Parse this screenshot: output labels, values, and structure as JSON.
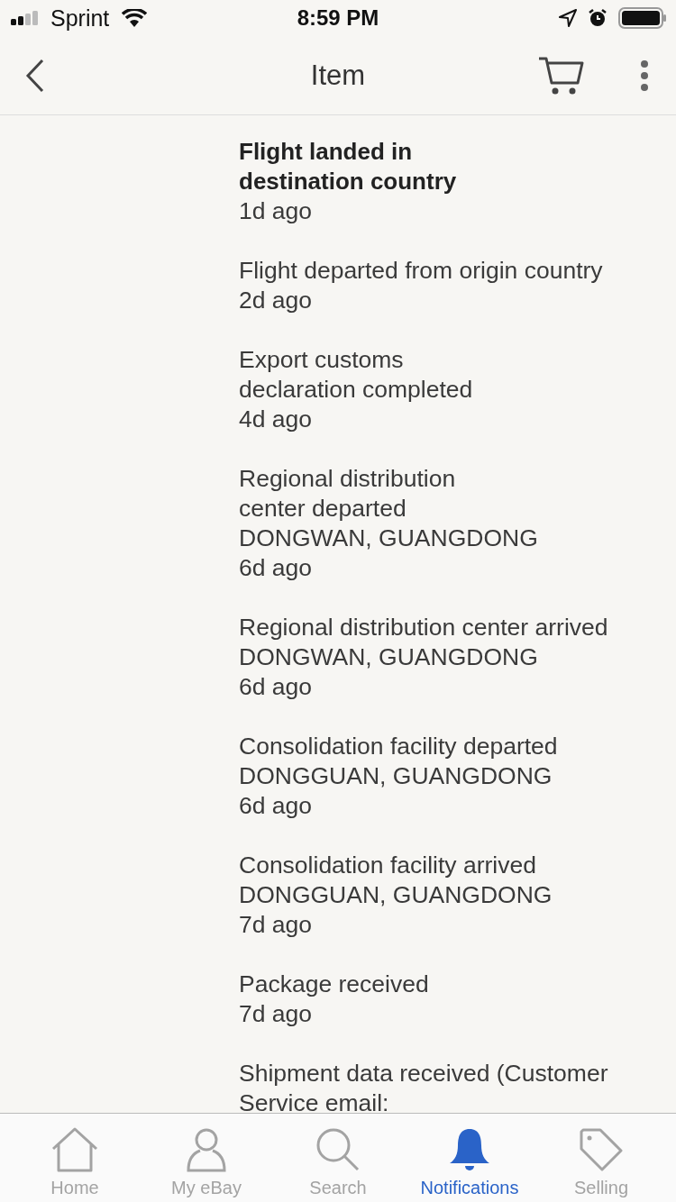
{
  "status_bar": {
    "carrier": "Sprint",
    "time": "8:59 PM"
  },
  "header": {
    "title": "Item"
  },
  "events": [
    {
      "title": "Flight landed in\ndestination country",
      "time": "1d ago",
      "latest": true
    },
    {
      "title": "Flight departed from origin country",
      "time": "2d ago",
      "latest": false
    },
    {
      "title": "Export customs\ndeclaration completed",
      "time": "4d ago",
      "latest": false
    },
    {
      "title": "Regional distribution\ncenter departed",
      "location": "DONGWAN, GUANGDONG",
      "time": "6d ago",
      "latest": false
    },
    {
      "title": "Regional distribution center arrived",
      "location": "DONGWAN, GUANGDONG",
      "time": "6d ago",
      "latest": false
    },
    {
      "title": "Consolidation facility departed",
      "location": "DONGGUAN, GUANGDONG",
      "time": "6d ago",
      "latest": false
    },
    {
      "title": "Consolidation facility arrived",
      "location": "DONGGUAN, GUANGDONG",
      "time": "7d ago",
      "latest": false
    },
    {
      "title": "Package received",
      "time": "7d ago",
      "latest": false
    },
    {
      "title": "Shipment data received (Customer\nService email:",
      "latest": false
    }
  ],
  "tabs": [
    {
      "label": "Home",
      "selected": false
    },
    {
      "label": "My eBay",
      "selected": false
    },
    {
      "label": "Search",
      "selected": false
    },
    {
      "label": "Notifications",
      "selected": true
    },
    {
      "label": "Selling",
      "selected": false
    }
  ]
}
